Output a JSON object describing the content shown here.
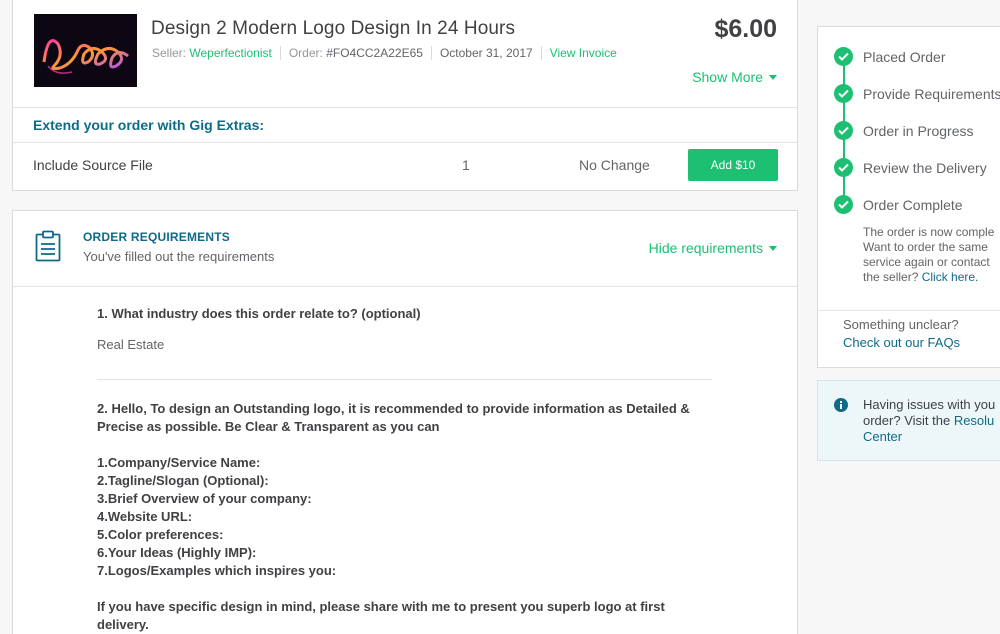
{
  "order": {
    "title": "Design 2 Modern Logo Design In 24 Hours",
    "price": "$6.00",
    "seller_label": "Seller:",
    "seller_name": "Weperfectionist",
    "order_label": "Order:",
    "order_id": "#FO4CC2A22E65",
    "date": "October 31, 2017",
    "view_invoice": "View Invoice",
    "show_more": "Show More",
    "thumb_text": "Logo"
  },
  "extras": {
    "title": "Extend your order with Gig Extras:",
    "items": [
      {
        "name": "Include Source File",
        "qty": "1",
        "change": "No Change",
        "button": "Add $10"
      }
    ]
  },
  "requirements": {
    "title": "ORDER REQUIREMENTS",
    "subtitle": "You've filled out the requirements",
    "toggle": "Hide requirements",
    "q1": "1. What industry does this order relate to? (optional)",
    "a1": "Real Estate",
    "q2": "2. Hello, To design an Outstanding logo, it is recommended to provide information as Detailed & Precise as possible. Be Clear & Transparent as you can",
    "list": [
      "1.Company/Service Name:",
      "2.Tagline/Slogan (Optional):",
      "3.Brief Overview of your company:",
      "4.Website URL:",
      "5.Color preferences:",
      "6.Your Ideas (Highly IMP):",
      "7.Logos/Examples which inspires you:"
    ],
    "closing": "If you have specific design in mind, please share with me to present you superb logo at first delivery."
  },
  "timeline": {
    "steps": [
      "Placed Order",
      "Provide Requirements",
      "Order in Progress",
      "Review the Delivery",
      "Order Complete"
    ],
    "complete_lines": [
      "The order is now comple",
      "Want to order the same",
      "service again or contact"
    ],
    "complete_last_prefix": "the seller? ",
    "complete_link": "Click here.",
    "unclear": "Something unclear?",
    "faq_link": "Check out our FAQs"
  },
  "issues": {
    "line1": "Having issues with you",
    "line2_prefix": "order? Visit the ",
    "line2_link": "Resolu",
    "line3_link": "Center"
  },
  "colors": {
    "accent_green": "#1dbf73",
    "link_blue": "#0e6b87",
    "info_bg": "#edf7fa"
  }
}
